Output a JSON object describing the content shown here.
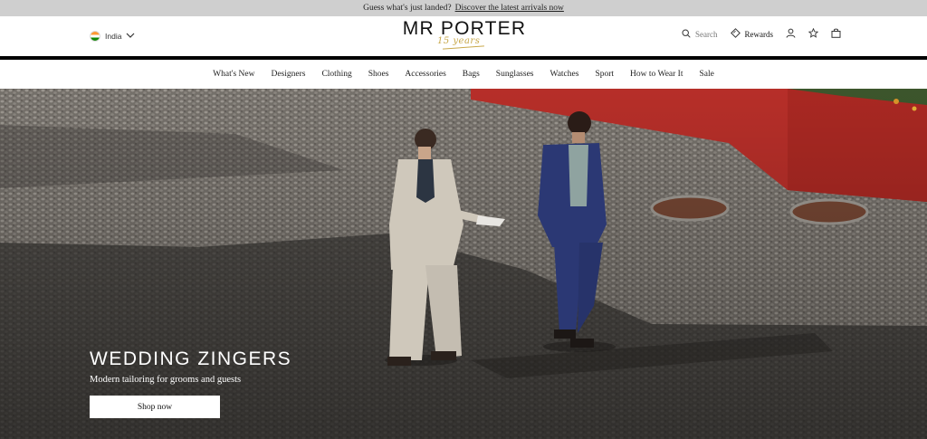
{
  "promo": {
    "text": "Guess what's just landed?",
    "link": "Discover the latest arrivals now"
  },
  "header": {
    "country": "India",
    "logo": "MR PORTER",
    "logo_script": "15 years",
    "search_label": "Search",
    "rewards_label": "Rewards"
  },
  "nav": {
    "items": [
      "What's New",
      "Designers",
      "Clothing",
      "Shoes",
      "Accessories",
      "Bags",
      "Sunglasses",
      "Watches",
      "Sport",
      "How to Wear It",
      "Sale"
    ]
  },
  "hero": {
    "title": "WEDDING ZINGERS",
    "subtitle": "Modern tailoring for grooms and guests",
    "cta": "Shop now"
  },
  "icons": {
    "country_chevron": "chevron-down-icon",
    "search": "search-icon",
    "rewards": "rewards-diamond-icon",
    "account": "user-icon",
    "wishlist": "star-icon",
    "bag": "shopping-bag-icon"
  },
  "colors": {
    "promo_bg": "#cfcfcf",
    "logo_gold": "#c8a84a",
    "wall_red": "#c0312b"
  }
}
